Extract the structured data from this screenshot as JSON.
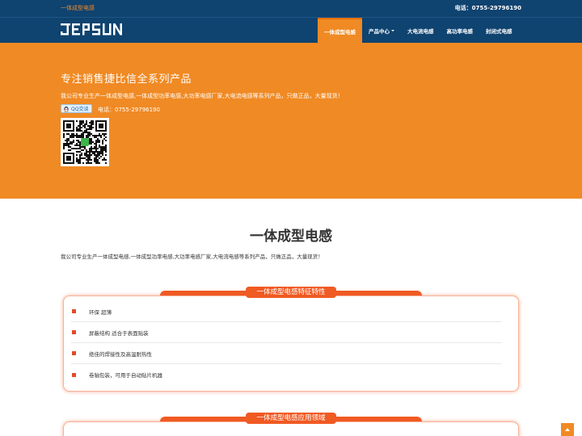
{
  "topbar": {
    "site_name": "一体成型电感",
    "phone": "电话：0755-29796190"
  },
  "brand": {
    "logo_text": "JEPSUN"
  },
  "nav": {
    "items": [
      {
        "label": "一体成型电感",
        "active": true
      },
      {
        "label": "产品中心",
        "dropdown": true
      },
      {
        "label": "大电流电感"
      },
      {
        "label": "高功率电感"
      },
      {
        "label": "封闭式电感"
      }
    ]
  },
  "hero": {
    "title": "专注销售捷比信全系列产品",
    "description": "我公司专业生产一体成型电感,一体成型功率电感,大功率电感厂家,大电流电感等系列产品，只做正品，大量现货！",
    "qq_label": "QQ交谈",
    "phone": "电话：0755-29796190"
  },
  "main": {
    "title": "一体成型电感",
    "description": "我公司专业生产一体成型电感,一体成型功率电感,大功率电感厂家,大电流电感等系列产品，只做正品，大量现货！"
  },
  "features_panel": {
    "heading": "一体成型电感特征特性",
    "items": [
      "环保  超薄",
      "屏蔽结构 适合于表面贴装",
      "绝佳的焊接性及高温耐热性",
      "卷轴包装，可用于自动贴片机器"
    ]
  },
  "applications_panel": {
    "heading": "一体成型电感应用领域"
  },
  "colors": {
    "navy": "#0f4370",
    "orange": "#f08a24",
    "red_orange": "#f05a23"
  }
}
